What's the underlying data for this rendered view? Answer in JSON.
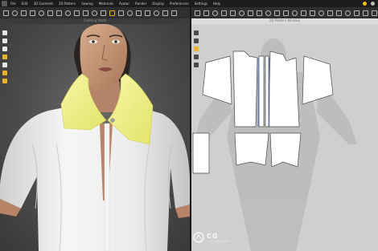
{
  "menubar": {
    "items": [
      "File",
      "Edit",
      "3D Garment",
      "2D Pattern",
      "Sewing",
      "Materials",
      "Avatar",
      "Render",
      "Display",
      "Preferences",
      "Settings",
      "Help"
    ]
  },
  "panels": {
    "left_title": "Clothing Mode",
    "right_title": "2D Pattern Window"
  },
  "watermark": {
    "text": "CG",
    "sub": "www.cgmodel.com"
  },
  "colors": {
    "background": "#2a2a2a",
    "pattern_window": "#cfcfcf",
    "collar_fabric": "#f0f08a",
    "accent_yellow": "#e8b42a"
  },
  "icons": {
    "status_circle_1": "record-icon",
    "status_circle_2": "settings-icon"
  }
}
